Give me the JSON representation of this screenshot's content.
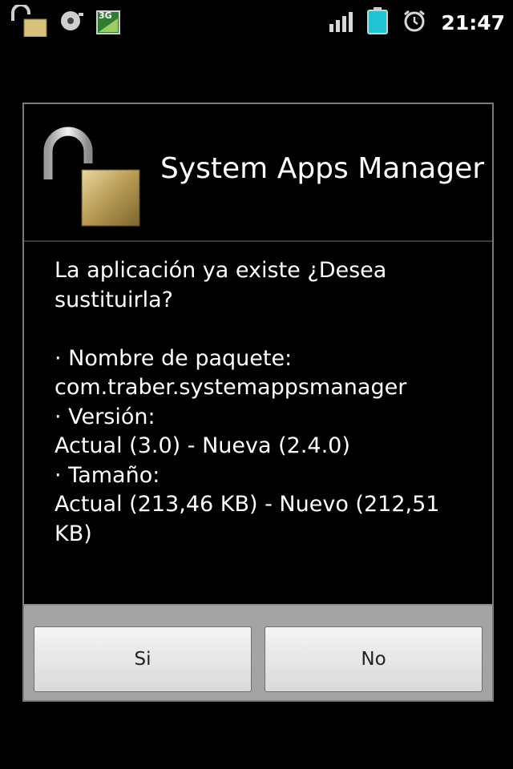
{
  "status_bar": {
    "time": "21:47",
    "network_badge": "3G",
    "icons": [
      "unlock-icon",
      "sd-card-icon",
      "3g-sim-icon",
      "signal-icon",
      "battery-icon",
      "alarm-icon"
    ],
    "battery_color": "#22c4d4"
  },
  "dialog": {
    "title": "System Apps Manager",
    "icon": "open-padlock-icon",
    "body": {
      "line1": "La aplicación ya existe ¿Desea",
      "line2": "sustituirla?",
      "line3": "· Nombre de paquete:",
      "line4": "com.traber.systemappsmanager",
      "line5": "· Versión:",
      "line6": "Actual (3.0) - Nueva (2.4.0)",
      "line7": "· Tamaño:",
      "line8": "Actual (213,46 KB) - Nuevo (212,51",
      "line9": "KB)"
    },
    "buttons": {
      "yes": "Si",
      "no": "No"
    }
  }
}
